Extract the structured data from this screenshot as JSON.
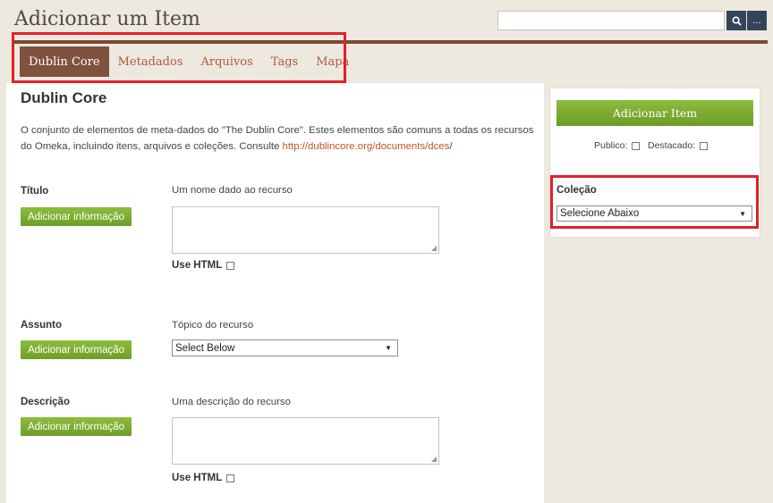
{
  "header": {
    "title": "Adicionar um Item",
    "search_value": "",
    "search_icon": "search-icon",
    "more_label": "..."
  },
  "tabs": [
    {
      "label": "Dublin Core",
      "active": true
    },
    {
      "label": "Metadados"
    },
    {
      "label": "Arquivos"
    },
    {
      "label": "Tags"
    },
    {
      "label": "Mapa"
    }
  ],
  "section": {
    "title": "Dublin Core",
    "intro": "O conjunto de elementos de meta-dados do \"The Dublin Core\". Estes elementos são comuns a todas os recursos do Omeka, incluindo itens, arquivos e coleções. Consulte ",
    "intro_link": "http://dublincore.org/documents/dces",
    "intro_end": "/"
  },
  "fields": {
    "titulo": {
      "label": "Título",
      "add_button": "Adicionar informação",
      "description": "Um nome dado ao recurso",
      "use_html": "Use HTML"
    },
    "assunto": {
      "label": "Assunto",
      "add_button": "Adicionar informação",
      "description": "Tópico do recurso",
      "select_value": "Select Below"
    },
    "descricao": {
      "label": "Descrição",
      "add_button": "Adicionar informação",
      "description": "Uma descrição do recurso",
      "use_html": "Use HTML"
    }
  },
  "sidebar": {
    "add_item_button": "Adicionar Item",
    "publico_label": "Publico:",
    "destacado_label": "Destacado:",
    "colecao_label": "Coleção",
    "colecao_value": "Selecione Abaixo"
  },
  "colors": {
    "accent_green": "#7aab31",
    "tab_active": "#80513e",
    "tab_text": "#b05a3b",
    "highlight": "#e2202a",
    "header_rule": "#7b4a34"
  }
}
